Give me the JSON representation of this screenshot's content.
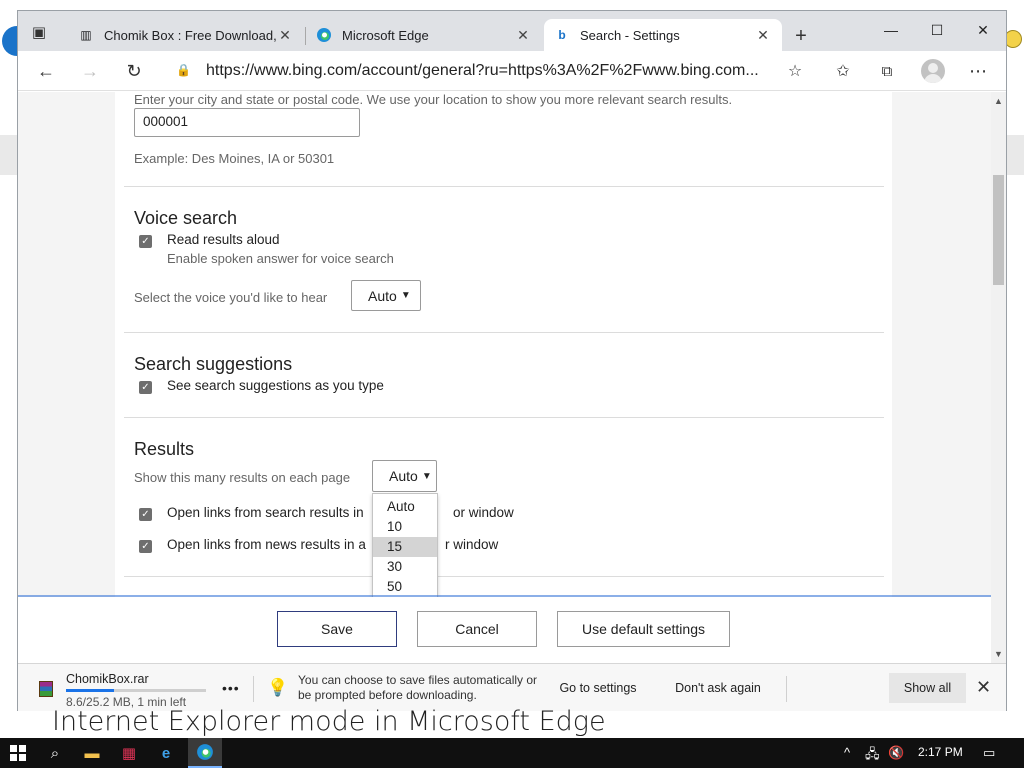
{
  "tabs": [
    {
      "title": "Chomik Box : Free Download, Bc",
      "icon": "chomikbox-favicon",
      "active": false
    },
    {
      "title": "Microsoft Edge",
      "icon": "edge-icon",
      "active": false
    },
    {
      "title": "Search - Settings",
      "icon": "bing-icon",
      "active": true
    }
  ],
  "toolbar": {
    "url": "https://www.bing.com/account/general?ru=https%3A%2F%2Fwww.bing.com..."
  },
  "location": {
    "description": "Enter your city and state or postal code. We use your location to show you more relevant search results.",
    "value": "000001",
    "example": "Example: Des Moines, IA or 50301"
  },
  "voice": {
    "title": "Voice search",
    "read_aloud_label": "Read results aloud",
    "read_aloud_sub": "Enable spoken answer for voice search",
    "voice_select_label": "Select the voice you'd like to hear",
    "voice_select_value": "Auto"
  },
  "suggestions": {
    "title": "Search suggestions",
    "label": "See search suggestions as you type"
  },
  "results": {
    "title": "Results",
    "count_label": "Show this many results on each page",
    "count_value": "Auto",
    "open_search_label_left": "Open links from search results in",
    "open_search_label_right": "or window",
    "open_news_label_left": "Open links from news results in a",
    "open_news_label_right": "r window",
    "dropdown_options": [
      "Auto",
      "10",
      "15",
      "30",
      "50"
    ],
    "highlighted_option": "15"
  },
  "buttons": {
    "save": "Save",
    "cancel": "Cancel",
    "default": "Use default settings"
  },
  "download": {
    "filename": "ChomikBox.rar",
    "meta": "8.6/25.2 MB, 1 min left",
    "progress": 0.34,
    "message": "You can choose to save files automatically or be prompted before downloading.",
    "go_settings": "Go to settings",
    "dont_ask": "Don't ask again",
    "show_all": "Show all"
  },
  "caption": "Internet Explorer mode in Microsoft Edge",
  "taskbar": {
    "clock": "2:17 PM"
  }
}
